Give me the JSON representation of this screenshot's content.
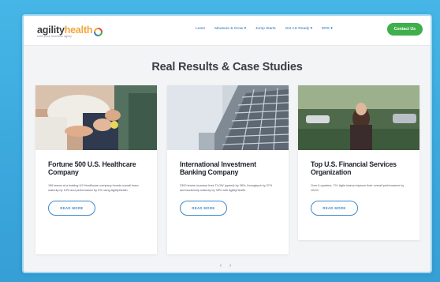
{
  "nav": {
    "logo_part1": "agility",
    "logo_part2": "health",
    "tagline": "enterprise business agility",
    "links": [
      "Learn",
      "Measure & Grow ▾",
      "Jump Starts",
      "Get AH Ready ▾",
      "ERS ▾"
    ],
    "contact": "Contact Us"
  },
  "heading": "Real Results & Case Studies",
  "cards": [
    {
      "title": "Fortune 500 U.S. Healthcare Company",
      "desc": "156 teams at a leading US Healthcare company boosts overall team maturity by 19% and performance by 5% using AgilityHealth.",
      "cta": "READ MORE"
    },
    {
      "title": "International Investment Banking Company",
      "desc": "2300 teams increase their TLOW (speed) by 28%, throughput by 37% and leadership maturity by 35% with AgilityHealth.",
      "cta": "READ MORE"
    },
    {
      "title": "Top U.S. Financial Services Organization",
      "desc": "Over 6 quarters, 70+ Agile teams improve their overall performance by 104%.",
      "cta": "READ MORE"
    }
  ],
  "pager": "‹ ›",
  "colors": {
    "accent_blue": "#3e86c8",
    "contact_green": "#3fae4d",
    "background_blue": "#3ba7dc"
  }
}
